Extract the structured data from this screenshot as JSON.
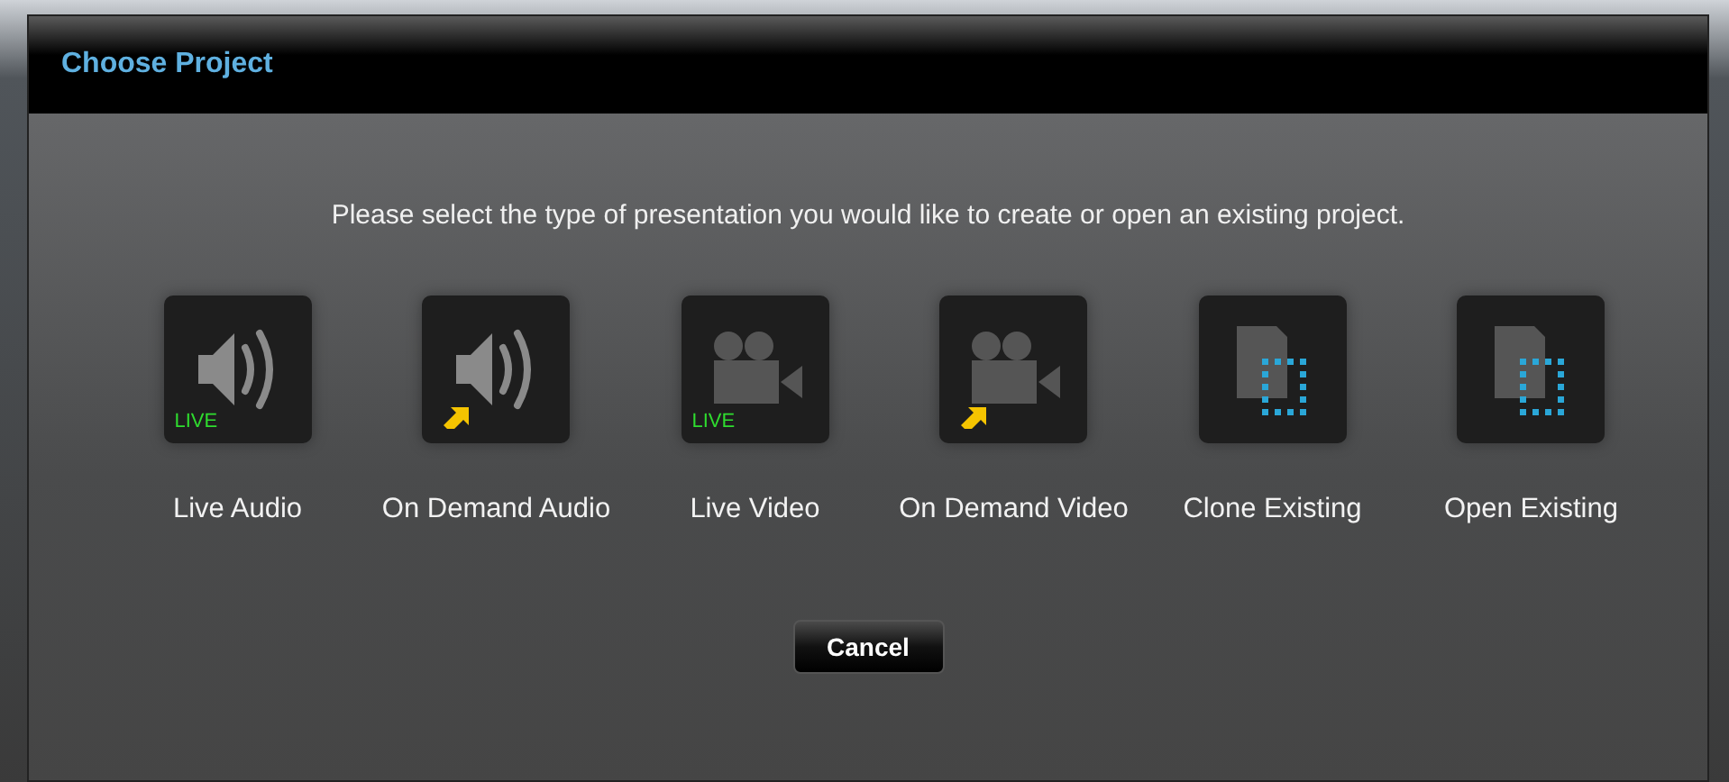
{
  "dialog": {
    "title": "Choose Project",
    "prompt": "Please select the type of presentation you would like to create or open an existing project."
  },
  "options": [
    {
      "label": "Live Audio",
      "kind": "audio",
      "badge": "LIVE",
      "arrow": false
    },
    {
      "label": "On Demand Audio",
      "kind": "audio",
      "arrow": true
    },
    {
      "label": "Live Video",
      "kind": "video",
      "badge": "LIVE",
      "arrow": false
    },
    {
      "label": "On Demand Video",
      "kind": "video",
      "arrow": true
    },
    {
      "label": "Clone Existing",
      "kind": "existing",
      "arrow": false
    },
    {
      "label": "Open Existing",
      "kind": "existing",
      "arrow": false
    }
  ],
  "buttons": [
    "Cancel"
  ]
}
